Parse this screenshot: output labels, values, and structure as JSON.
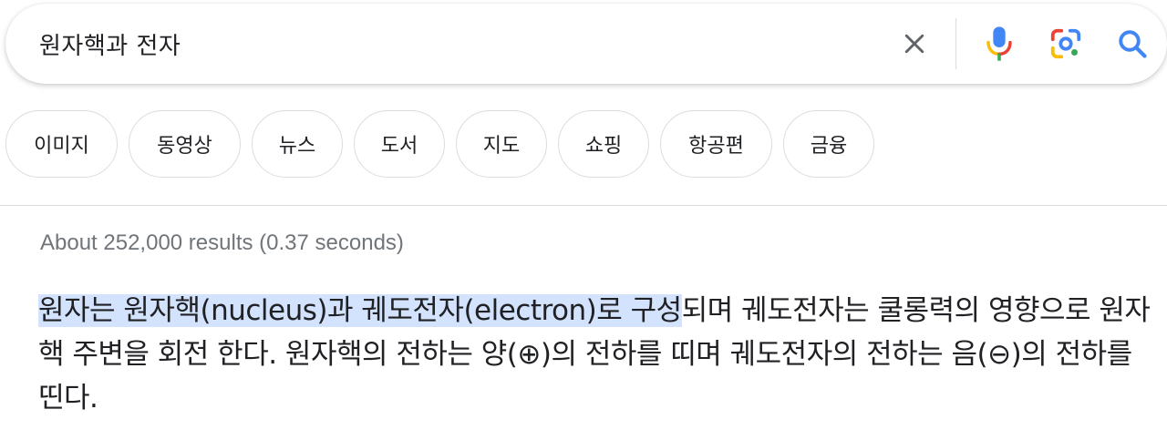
{
  "search": {
    "query": "원자핵과 전자",
    "clear_icon": "close-icon",
    "voice_icon": "mic-icon",
    "lens_icon": "camera-lens-icon",
    "search_icon": "search-icon"
  },
  "chips": [
    {
      "label": "이미지"
    },
    {
      "label": "동영상"
    },
    {
      "label": "뉴스"
    },
    {
      "label": "도서"
    },
    {
      "label": "지도"
    },
    {
      "label": "쇼핑"
    },
    {
      "label": "항공편"
    },
    {
      "label": "금융"
    }
  ],
  "results": {
    "stats": "About 252,000 results (0.37 seconds)"
  },
  "snippet": {
    "highlighted": "원자는 원자핵(nucleus)과 궤도전자(electron)로 구성",
    "rest": "되며 궤도전자는 쿨롱력의 영향으로 원자핵 주변을 회전 한다. 원자핵의 전하는 양(⊕)의 전하를 띠며 궤도전자의 전하는 음(⊖)의 전하를 띤다."
  },
  "colors": {
    "google_blue": "#4285f4",
    "google_red": "#ea4335",
    "google_yellow": "#fbbc05",
    "google_green": "#34a853",
    "highlight": "#d3e3fd"
  }
}
